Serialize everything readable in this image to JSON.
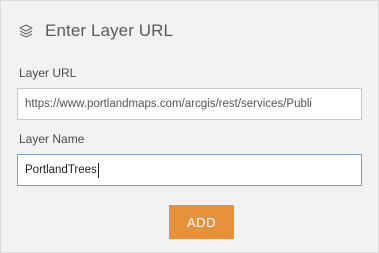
{
  "header": {
    "title": "Enter Layer URL",
    "icon": "layers-icon"
  },
  "form": {
    "url_label": "Layer URL",
    "url_value": "https://www.portlandmaps.com/arcgis/rest/services/Publi",
    "name_label": "Layer Name",
    "name_value": "PortlandTrees"
  },
  "actions": {
    "add_label": "ADD"
  },
  "colors": {
    "accent": "#e8913b",
    "panel_bg": "#f2f2f2",
    "focus_border": "#7a9cc9"
  }
}
